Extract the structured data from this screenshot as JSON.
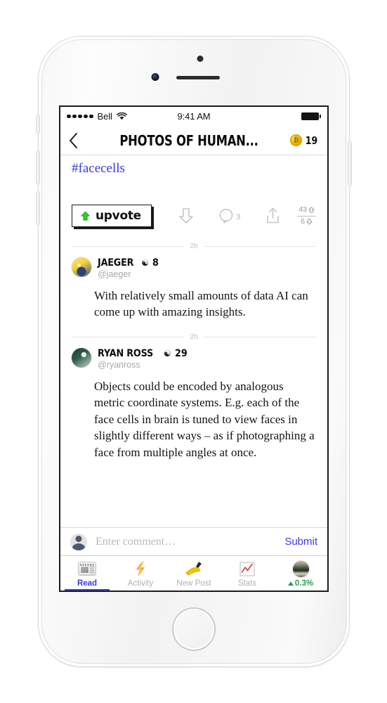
{
  "status_bar": {
    "carrier": "Bell",
    "time": "9:41 AM",
    "signal_dots": 5,
    "wifi_icon": "wifi-icon",
    "battery_icon": "battery-full-icon"
  },
  "nav_bar": {
    "back_icon": "chevron-left-icon",
    "title": "PHOTOS OF HUMAN...",
    "coin_icon": "coin-icon",
    "coin_glyph": "₿",
    "coin_count": "19"
  },
  "post": {
    "hashtag": "#facecells",
    "actions": {
      "upvote_label": "upvote",
      "upvote_icon": "up-arrow-icon",
      "downvote_icon": "down-arrow-icon",
      "comment_icon": "comment-bubble-icon",
      "comment_count": "3",
      "share_icon": "share-icon",
      "tally_up_count": "43",
      "tally_up_icon": "up-arrow-icon",
      "tally_down_count": "6",
      "tally_down_icon": "down-arrow-icon"
    }
  },
  "comments": [
    {
      "divider_time": "2h",
      "avatar": "avatar-jaeger",
      "display_name": "JAEGER",
      "badge_icon": "reputation-badge-icon",
      "reputation": "8",
      "handle": "@jaeger",
      "body": "With relatively small amounts of data AI can come up with amazing insights."
    },
    {
      "divider_time": "2h",
      "avatar": "avatar-ryan",
      "display_name": "RYAN ROSS",
      "badge_icon": "reputation-badge-icon",
      "reputation": "29",
      "handle": "@ryanross",
      "body": "Objects could be encoded by analogous metric coordinate systems. E.g. each of the face cells in brain is tuned to view faces in slightly different ways – as if photographing a face from multiple angles at once."
    }
  ],
  "composer": {
    "avatar_icon": "user-avatar-icon",
    "placeholder": "Enter comment…",
    "value": "",
    "submit_label": "Submit"
  },
  "tab_bar": {
    "tabs": [
      {
        "label": "Read",
        "icon": "newspaper-icon",
        "active": true
      },
      {
        "label": "Activity",
        "icon": "lightning-bolt-icon",
        "active": false
      },
      {
        "label": "New Post",
        "icon": "pencil-writing-icon",
        "active": false
      },
      {
        "label": "Stats",
        "icon": "line-chart-icon",
        "active": false
      }
    ],
    "profile": {
      "avatar_icon": "profile-avatar-icon",
      "change_icon": "triangle-up-icon",
      "change_value": "0.3%"
    }
  },
  "colors": {
    "accent_blue": "#3b3bdd",
    "upvote_green": "#2ecb2e",
    "gain_green": "#2e9e4f",
    "coin_gold": "#f2b705"
  }
}
